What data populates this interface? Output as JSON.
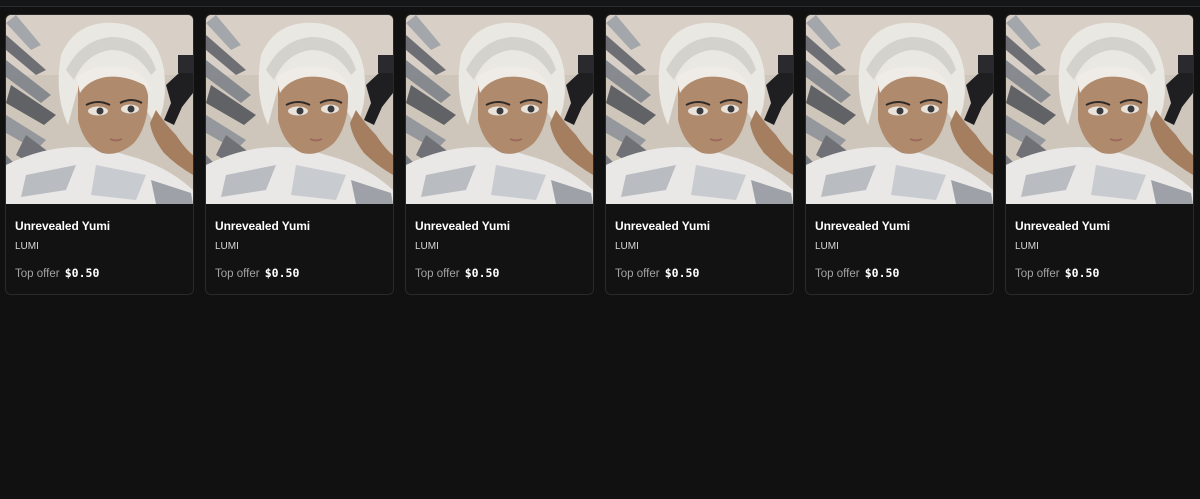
{
  "colors": {
    "background": "#111111",
    "card_background": "#121212",
    "card_border": "#2a2a2a",
    "muted_text": "#a3a3a3"
  },
  "cards": [
    {
      "name": "Unrevealed Yumi",
      "collection": "LUMI",
      "offer_label": "Top offer",
      "offer_price": "$0.50",
      "image": "anime-girl-with-pistol-artwork"
    },
    {
      "name": "Unrevealed Yumi",
      "collection": "LUMI",
      "offer_label": "Top offer",
      "offer_price": "$0.50",
      "image": "anime-girl-with-pistol-artwork"
    },
    {
      "name": "Unrevealed Yumi",
      "collection": "LUMI",
      "offer_label": "Top offer",
      "offer_price": "$0.50",
      "image": "anime-girl-with-pistol-artwork"
    },
    {
      "name": "Unrevealed Yumi",
      "collection": "LUMI",
      "offer_label": "Top offer",
      "offer_price": "$0.50",
      "image": "anime-girl-with-pistol-artwork"
    },
    {
      "name": "Unrevealed Yumi",
      "collection": "LUMI",
      "offer_label": "Top offer",
      "offer_price": "$0.50",
      "image": "anime-girl-with-pistol-artwork"
    },
    {
      "name": "Unrevealed Yumi",
      "collection": "LUMI",
      "offer_label": "Top offer",
      "offer_price": "$0.50",
      "image": "anime-girl-with-pistol-artwork"
    }
  ]
}
